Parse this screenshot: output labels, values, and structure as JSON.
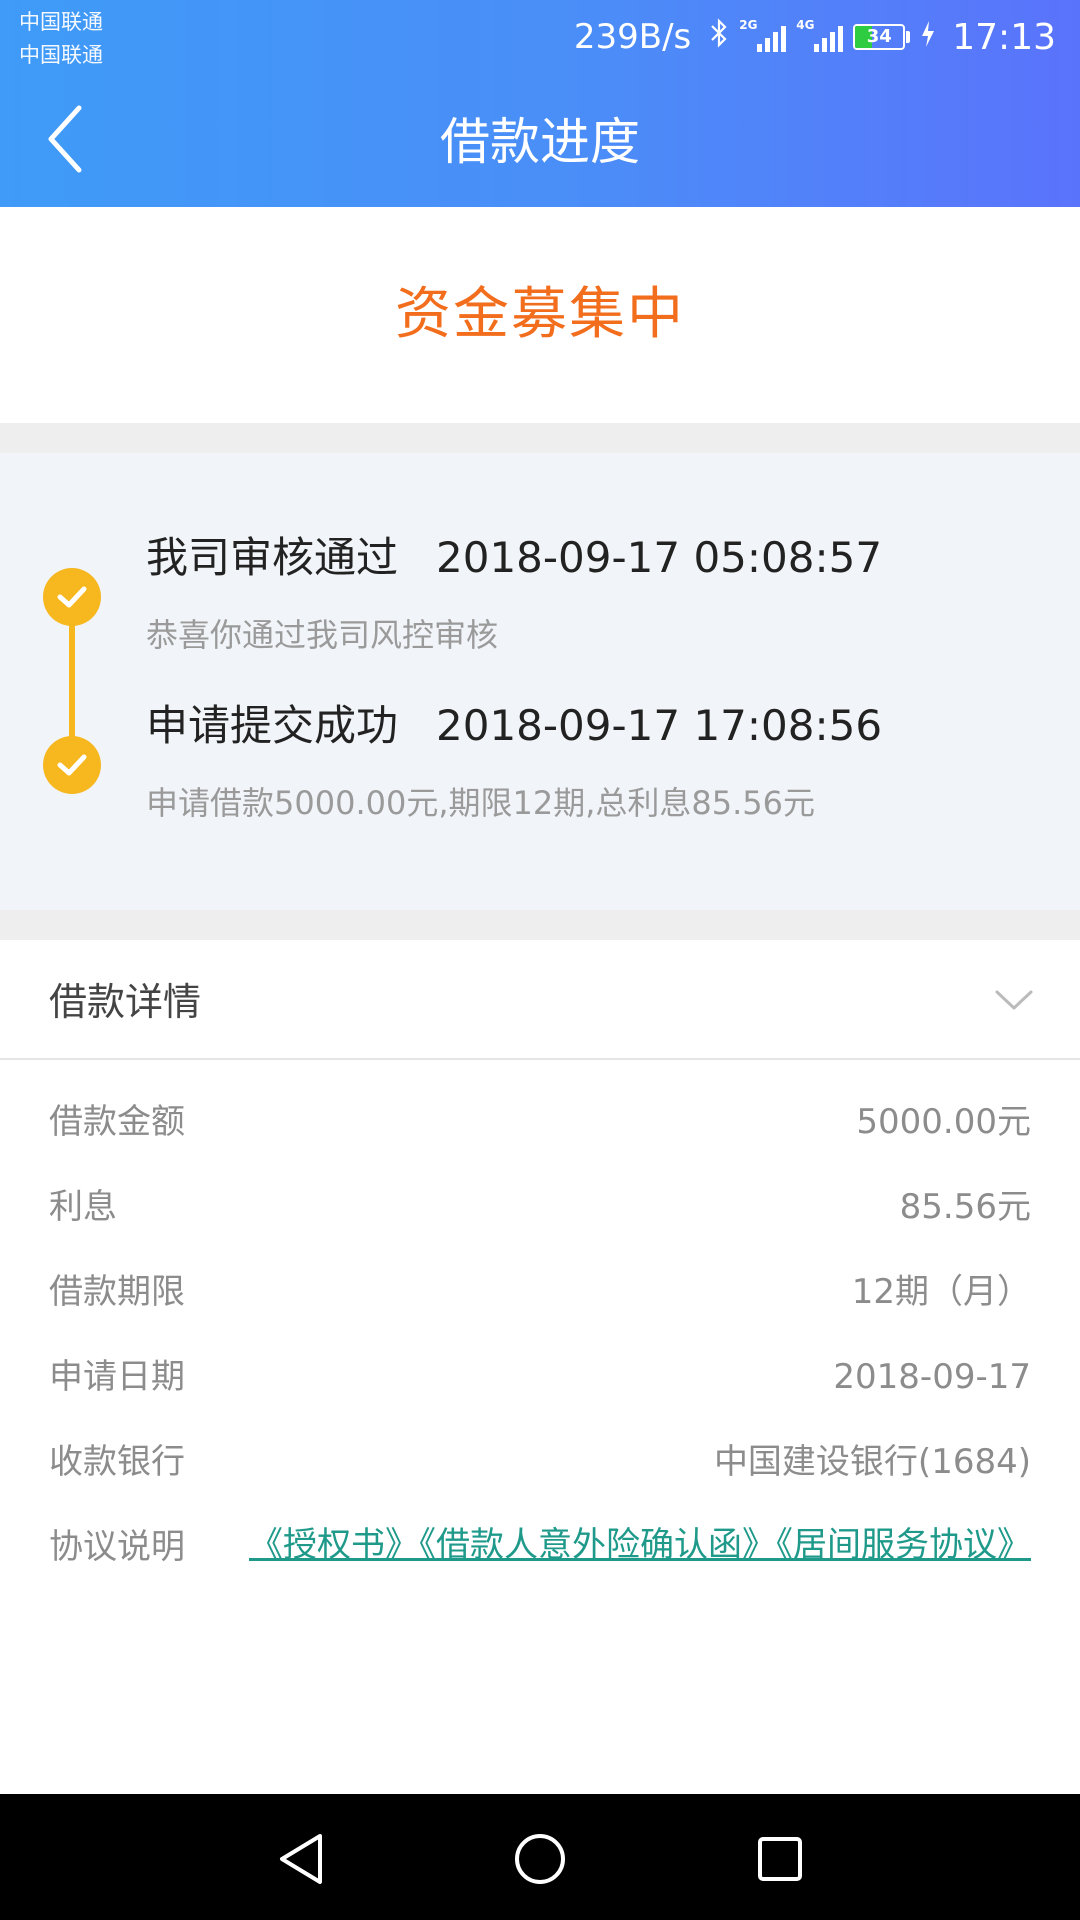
{
  "status_bar": {
    "carrier1": "中国联通",
    "carrier2": "中国联通",
    "net_speed": "239B/s",
    "signal1_type": "2G",
    "signal2_type": "4G",
    "battery": "34",
    "battery_level": 0.34,
    "time": "17:13"
  },
  "nav": {
    "title": "借款进度"
  },
  "banner": {
    "status": "资金募集中"
  },
  "timeline": [
    {
      "title": "我司审核通过",
      "time": "2018-09-17 05:08:57",
      "desc": "恭喜你通过我司风控审核"
    },
    {
      "title": "申请提交成功",
      "time": "2018-09-17 17:08:56",
      "desc": "申请借款5000.00元,期限12期,总利息85.56元"
    }
  ],
  "details": {
    "title": "借款详情",
    "rows": [
      {
        "label": "借款金额",
        "value": "5000.00元"
      },
      {
        "label": "利息",
        "value": "85.56元"
      },
      {
        "label": "借款期限",
        "value": "12期（月）"
      },
      {
        "label": "申请日期",
        "value": "2018-09-17"
      },
      {
        "label": "收款银行",
        "value": "中国建设银行(1684)"
      }
    ],
    "agreement_label": "协议说明",
    "agreements": [
      "《授权书》",
      "《借款人意外险确认函》",
      "《居间服务协议》"
    ]
  },
  "colors": {
    "header_start": "#3f9bf7",
    "header_end": "#5a73fb",
    "status_orange": "#f26d1c",
    "timeline_yellow": "#f6b71f",
    "link_teal": "#1f9a8a"
  }
}
